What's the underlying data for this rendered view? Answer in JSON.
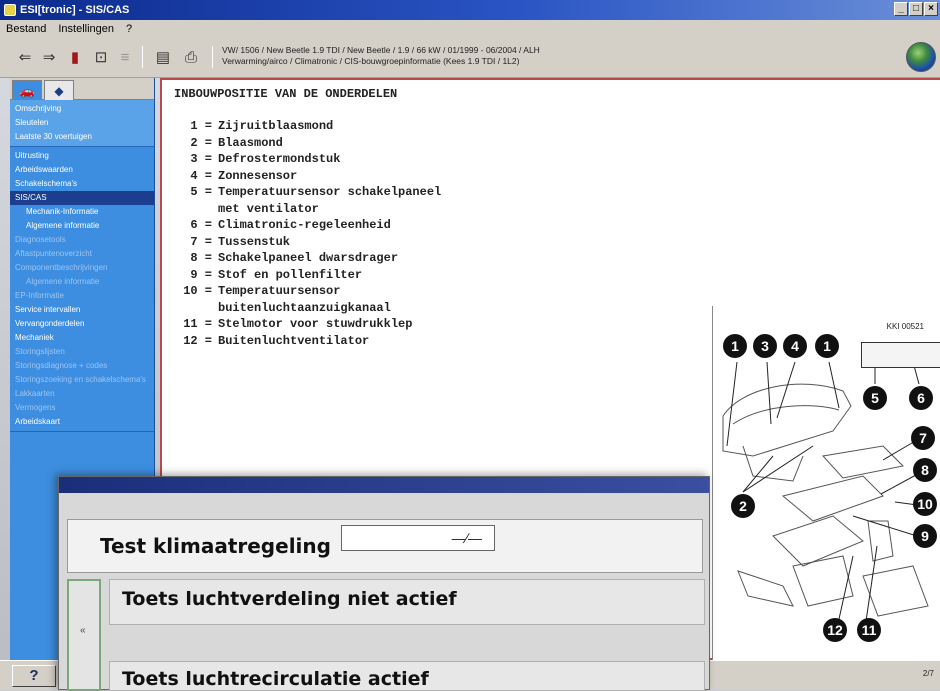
{
  "window": {
    "title": "ESI[tronic] - SIS/CAS",
    "controls": [
      "_",
      "□",
      "×"
    ]
  },
  "menu": {
    "items": [
      "Bestand",
      "Instellingen",
      "?"
    ]
  },
  "toolbar": {
    "vehicle_line1": "VW/ 1506 / New Beetle 1.9 TDI / New Beetle / 1.9 / 66 kW / 01/1999 - 06/2004 / ALH",
    "vehicle_line2": "Verwarming/airco / Climatronic / CIS-bouwgroepinformatie (Kees 1.9 TDI / 1L2)"
  },
  "sidebar": {
    "group1": [
      "Omschrijving",
      "Sleutelen",
      "Laatste 30 voertuigen"
    ],
    "group2": [
      {
        "label": "Uitrusting",
        "state": "normal"
      },
      {
        "label": "Arbeidswaarden",
        "state": "normal"
      },
      {
        "label": "Schakelschema's",
        "state": "normal"
      },
      {
        "label": "SIS/CAS",
        "state": "selected"
      },
      {
        "label": "Mechanik-Informatie",
        "state": "sub"
      },
      {
        "label": "Algemene informatie",
        "state": "sub"
      },
      {
        "label": "Diagnosetools",
        "state": "disabled"
      },
      {
        "label": "Aftastpuntenoverzicht",
        "state": "disabled"
      },
      {
        "label": "Componentbeschrijvingen",
        "state": "disabled"
      },
      {
        "label": "Algemene informatie",
        "state": "disabled-sub"
      },
      {
        "label": "EP-Informatie",
        "state": "disabled"
      },
      {
        "label": "Service intervallen",
        "state": "normal"
      },
      {
        "label": "Vervangonderdelen",
        "state": "normal"
      },
      {
        "label": "Mechaniek",
        "state": "normal"
      },
      {
        "label": "Storingslijsten",
        "state": "disabled"
      },
      {
        "label": "Storingsdiagnose + codes",
        "state": "disabled"
      },
      {
        "label": "Storingszoeking en schakelschema's",
        "state": "disabled"
      },
      {
        "label": "Lakkaarten",
        "state": "disabled"
      },
      {
        "label": "Vermogens",
        "state": "disabled"
      },
      {
        "label": "Arbeidskaart",
        "state": "normal"
      }
    ]
  },
  "content": {
    "heading": "INBOUWPOSITIE VAN DE ONDERDELEN",
    "parts": [
      {
        "num": "1 =",
        "label": "Zijruitblaasmond"
      },
      {
        "num": "2 =",
        "label": "Blaasmond"
      },
      {
        "num": "3 =",
        "label": "Defrostermondstuk"
      },
      {
        "num": "4 =",
        "label": "Zonnesensor"
      },
      {
        "num": "5 =",
        "label": "Temperatuursensor schakelpaneel"
      },
      {
        "num": "",
        "label": "met ventilator"
      },
      {
        "num": "6 =",
        "label": "Climatronic-regeleenheid"
      },
      {
        "num": "7 =",
        "label": "Tussenstuk"
      },
      {
        "num": "8 =",
        "label": "Schakelpaneel dwarsdrager"
      },
      {
        "num": "9 =",
        "label": "Stof en pollenfilter"
      },
      {
        "num": "10 =",
        "label": "Temperatuursensor"
      },
      {
        "num": "",
        "label": "buitenluchtaanzuigkanaal"
      },
      {
        "num": "11 =",
        "label": "Stelmotor voor stuwdrukklep"
      },
      {
        "num": "12 =",
        "label": "Buitenluchtventilator"
      }
    ]
  },
  "figure": {
    "code": "KKI 00521",
    "callouts": [
      "1",
      "3",
      "4",
      "1",
      "5",
      "6",
      "7",
      "2",
      "8",
      "10",
      "9",
      "12",
      "11"
    ]
  },
  "statusbar": {
    "help_label": "?",
    "page": "2/7"
  },
  "test_window": {
    "title": "Test klimaatregeling",
    "marker": "«",
    "row1_label": "Toets luchtverdeling niet actief",
    "switch_symbol": "—∕—",
    "row2_label": "Toets luchtrecirculatie actief"
  }
}
